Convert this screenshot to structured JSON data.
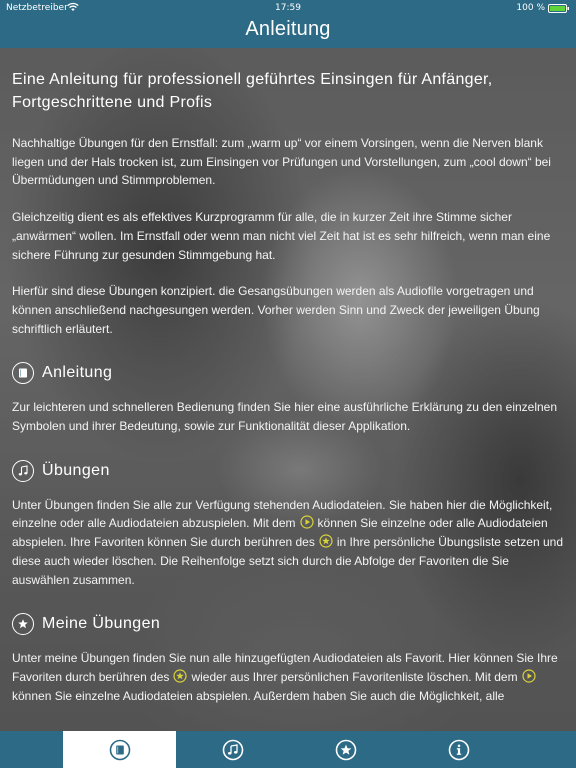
{
  "status_bar": {
    "carrier": "Netzbetreiber",
    "time": "17:59",
    "battery": "100 %"
  },
  "nav": {
    "title": "Anleitung"
  },
  "intro": {
    "title": "Eine Anleitung für professionell geführtes Einsingen für Anfänger, Fortgeschrittene und Profis",
    "paragraphs": [
      "Nachhaltige Übungen für den Ernstfall: zum „warm up“ vor einem Vorsingen, wenn die Nerven blank liegen und der Hals trocken ist, zum Einsingen vor Prüfungen und Vorstellungen, zum „cool down“ bei Übermüdungen und Stimmproblemen.",
      "Gleichzeitig dient es als effektives Kurzprogramm für alle, die in kurzer Zeit ihre Stimme sicher „anwärmen“ wollen. Im Ernstfall oder wenn man nicht viel Zeit hat ist es sehr hilfreich, wenn man eine sichere Führung zur gesunden Stimmgebung hat.",
      "Hierfür sind diese Übungen konzipiert. die Gesangsübungen werden als Audiofile vorgetragen und können anschließend nachgesungen werden. Vorher werden Sinn und Zweck der jeweiligen Übung schriftlich erläutert."
    ]
  },
  "sections": {
    "anleitung": {
      "icon": "book-icon",
      "title": "Anleitung",
      "text": "Zur leichteren und schnelleren Bedienung finden Sie hier eine ausführliche Erklärung zu den einzelnen Symbolen und ihrer Bedeutung, sowie zur Funktionalität dieser Applikation."
    },
    "uebungen": {
      "icon": "music-note-icon",
      "title": "Übungen",
      "text_1": "Unter Übungen finden Sie alle zur Verfügung stehenden Audiodateien. Sie haben hier die Möglichkeit, einzelne oder alle Audiodateien abzuspielen. Mit dem",
      "text_2": "können Sie einzelne oder alle Audiodateien abspielen. Ihre Favoriten können Sie durch berühren des",
      "text_3": "in Ihre persönliche Übungsliste setzen und diese auch wieder löschen. Die Reihenfolge setzt sich durch die Abfolge der Favoriten die Sie auswählen zusammen."
    },
    "meine_uebungen": {
      "icon": "star-icon",
      "title": "Meine Übungen",
      "text_1": "Unter meine Übungen finden Sie nun alle hinzugefügten Audiodateien als Favorit. Hier können Sie Ihre Favoriten durch berühren des",
      "text_2": "wieder aus Ihrer persönlichen Favoritenliste löschen. Mit dem",
      "text_3": "können Sie einzelne Audiodateien abspielen. Außerdem haben Sie auch die Möglichkeit, alle"
    }
  },
  "tabs": [
    {
      "icon": "book-icon",
      "active": true
    },
    {
      "icon": "music-note-icon",
      "active": false
    },
    {
      "icon": "star-icon",
      "active": false
    },
    {
      "icon": "info-icon",
      "active": false
    }
  ],
  "colors": {
    "bar": "#2c6a85",
    "accent_yellow": "#d8d23a",
    "text": "#f2f2f2"
  }
}
